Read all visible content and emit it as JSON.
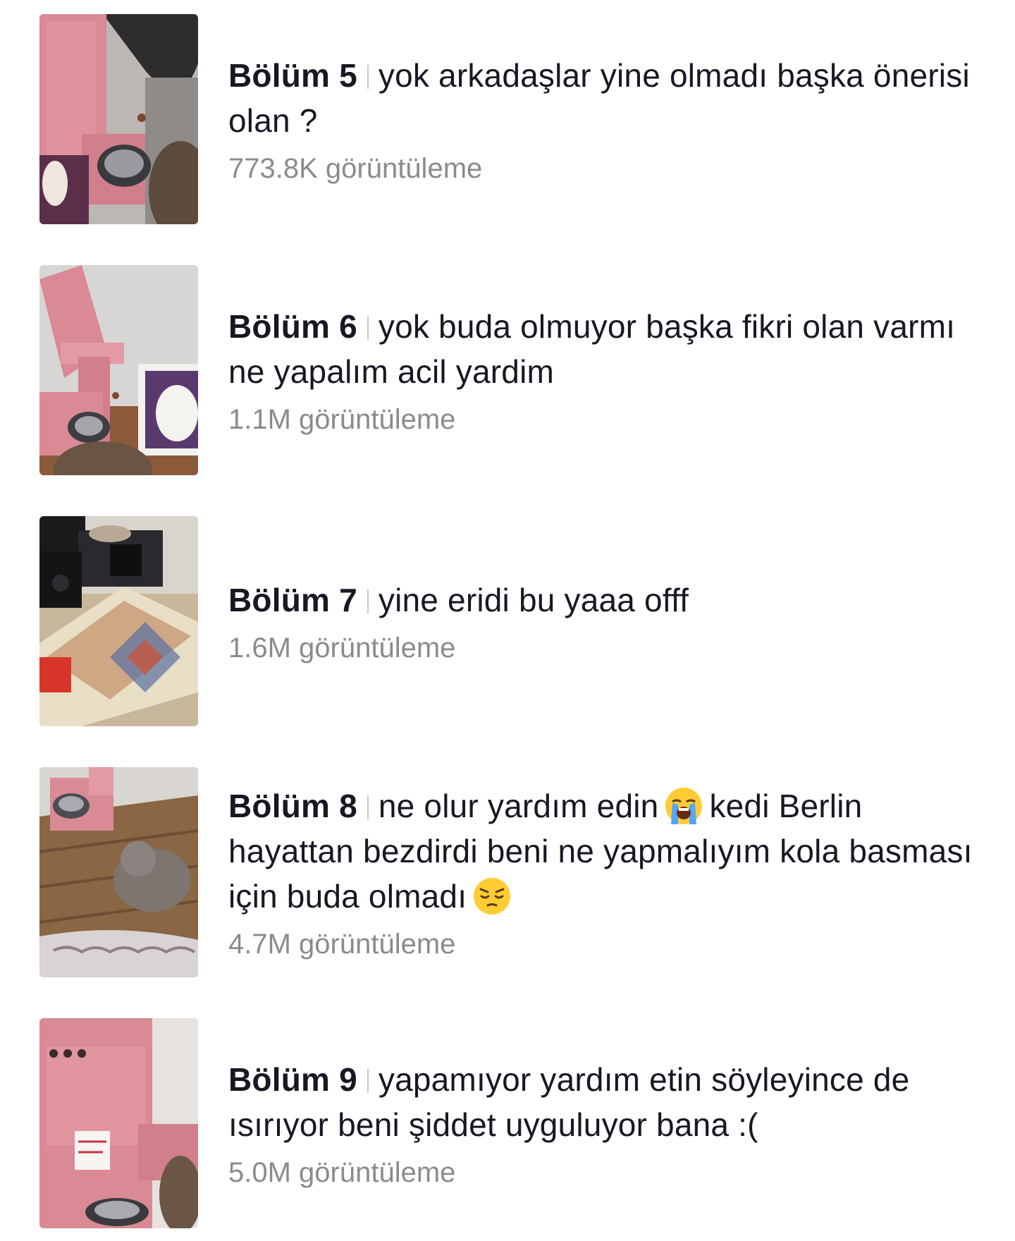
{
  "episodes": [
    {
      "episode": "Bölüm 5",
      "description": "yok arkadaşlar yine olmadı başka önerisi olan ?",
      "views": "773.8K görüntüleme",
      "thumbnail_icon": "pink-cat-feeder-photo"
    },
    {
      "episode": "Bölüm 6",
      "description": "yok buda olmuyor başka fikri olan varmı ne yapalım acil yardim",
      "views": "1.1M görüntüleme",
      "thumbnail_icon": "pink-cat-feeder-photo"
    },
    {
      "episode": "Bölüm 7",
      "description": "yine eridi bu yaaa offf",
      "views": "1.6M görüntüleme",
      "thumbnail_icon": "room-rug-cat-photo"
    },
    {
      "episode": "Bölüm 8",
      "description_part1": "ne olur yardım edin",
      "description_part2": "kedi Berlin hayattan bezdirdi beni ne yapmalıyım kola basması için buda olmadı",
      "emoji1": "loudly-crying-face-emoji",
      "emoji2": "pensive-face-emoji",
      "views": "4.7M görüntüleme",
      "thumbnail_icon": "cat-on-floor-photo"
    },
    {
      "episode": "Bölüm 9",
      "description": "yapamıyor yardım etin söyleyince de ısırıyor beni şiddet uyguluyor bana :(",
      "views": "5.0M görüntüleme",
      "thumbnail_icon": "pink-cat-feeder-photo"
    }
  ],
  "colors": {
    "title": "#161823",
    "views": "#8a8b91",
    "separator": "#c8c9cc",
    "feeder_pink": "#d98a95"
  }
}
